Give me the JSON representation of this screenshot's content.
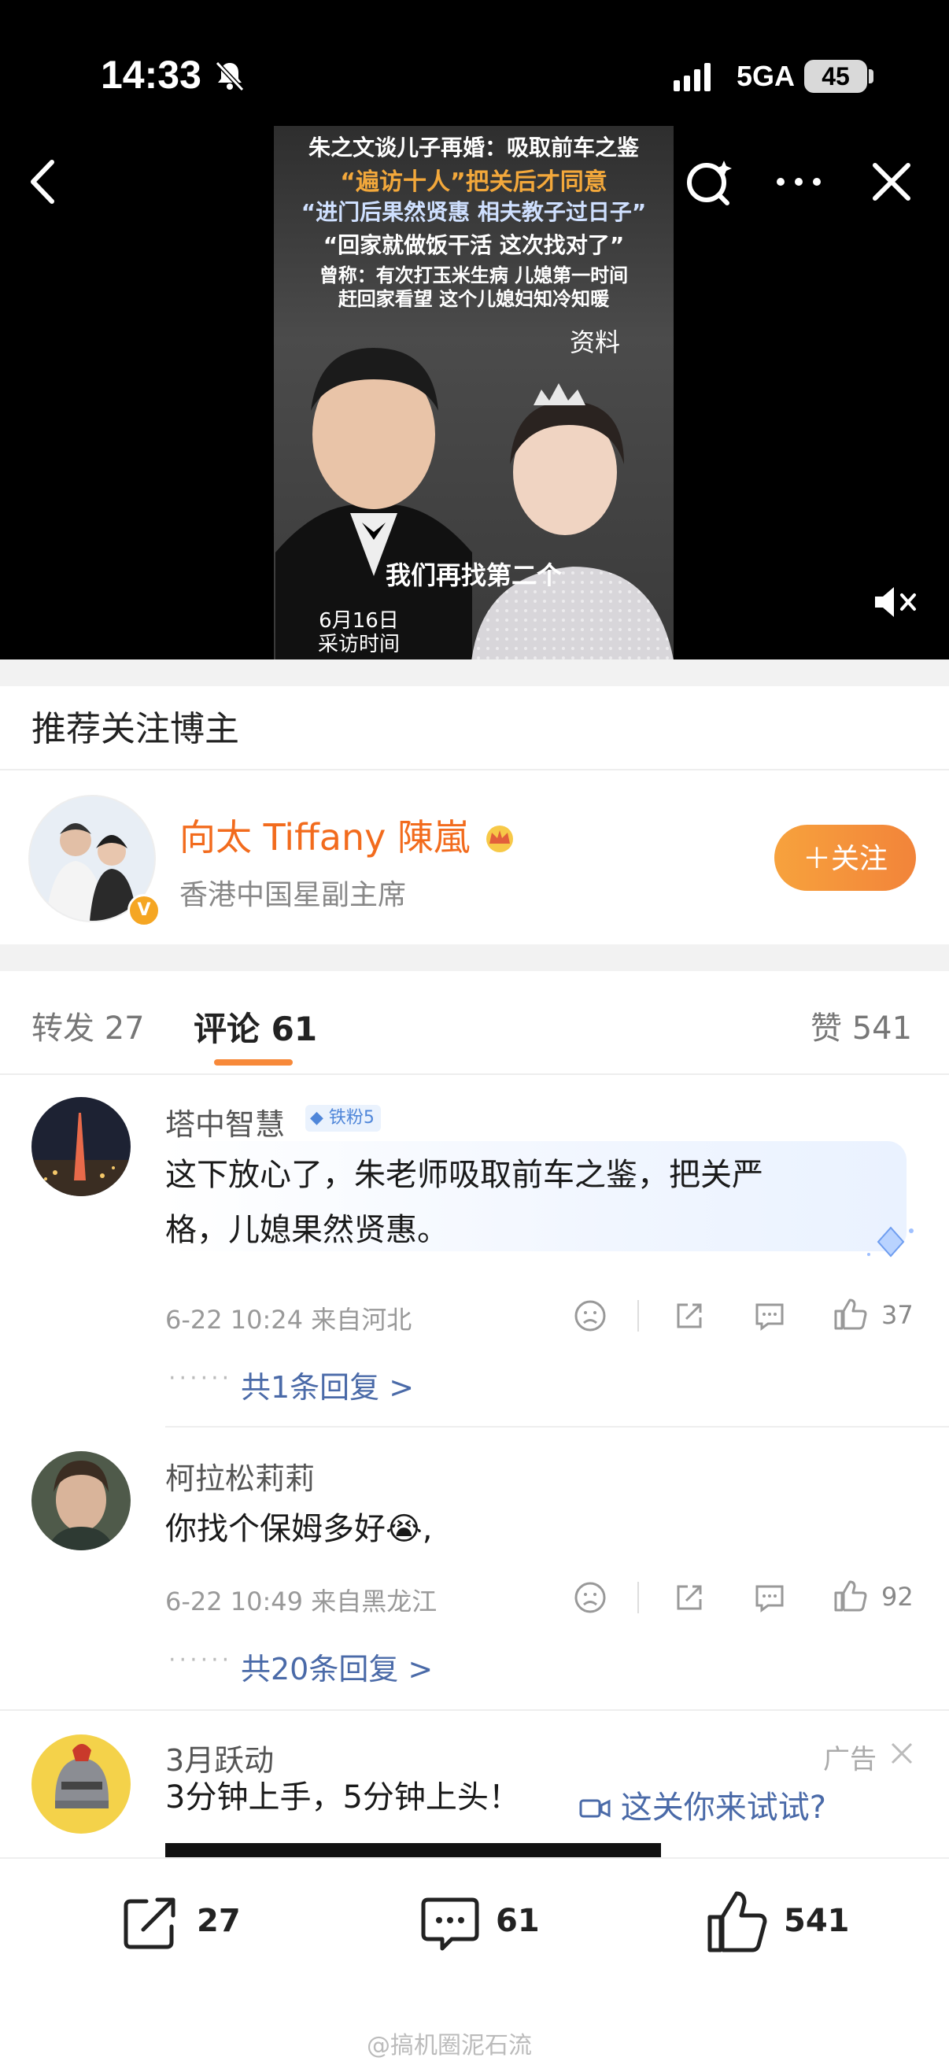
{
  "status_bar": {
    "time": "14:33",
    "network": "5GA",
    "battery": "45"
  },
  "video": {
    "lines": [
      "朱之文谈儿子再婚：吸取前车之鉴",
      "“遍访十人”把关后才同意",
      "“进门后果然贤惠 相夫教子过日子”",
      "“回家就做饭干活 这次找对了”",
      "曾称：有次打玉米生病 儿媳第一时间",
      "赶回家看望 这个儿媳妇知冷知暖"
    ],
    "tag": "资料",
    "subtitle": "我们再找第二个",
    "date_line1": "6月16日",
    "date_line2": "采访时间"
  },
  "recommend": {
    "title": "推荐关注博主",
    "name": "向太 Tiffany 陳嵐",
    "desc": "香港中国星副主席",
    "follow_label": "＋关注",
    "verified_mark": "V"
  },
  "tabs": {
    "repost": "转发 27",
    "comments": "评论 61",
    "likes": "赞 541"
  },
  "comments": [
    {
      "name": "塔中智慧",
      "badge": "铁粉5",
      "text_line1": "这下放心了，朱老师吸取前车之鉴，把关严",
      "text_line2": "格，儿媳果然贤惠。",
      "meta": "6-22 10:24 来自河北",
      "likes": "37",
      "replies": "共1条回复 >"
    },
    {
      "name": "柯拉松莉莉",
      "text": "你找个保姆多好😭,",
      "meta": "6-22 10:49 来自黑龙江",
      "likes": "92",
      "replies": "共20条回复 >"
    }
  ],
  "ad": {
    "name": "3月跃动",
    "label": "广告",
    "text": "3分钟上手，5分钟上头！",
    "link": "这关你来试试?"
  },
  "bottom_bar": {
    "reposts": "27",
    "comments": "61",
    "likes": "541"
  },
  "watermark": "@搞机圈泥石流",
  "colors": {
    "accent_orange": "#f7893a",
    "link_blue": "#4a6aa8",
    "name_orange": "#f26b1d"
  }
}
